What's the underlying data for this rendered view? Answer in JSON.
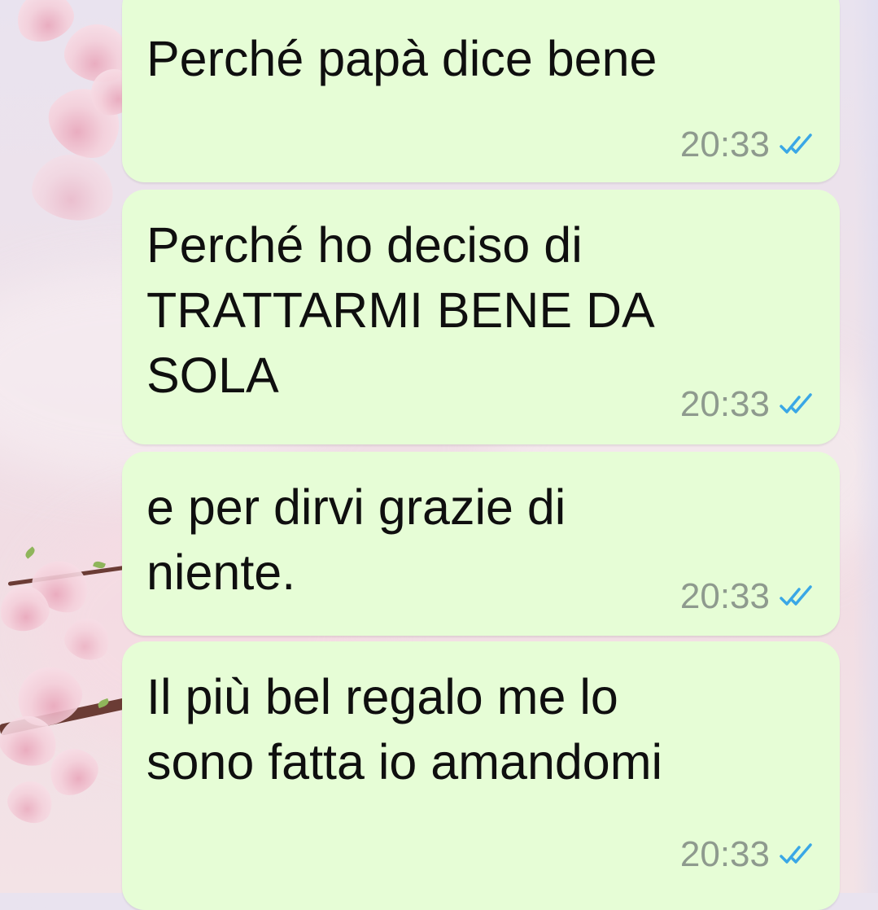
{
  "chat": {
    "messages": [
      {
        "text": "Perché papà dice bene",
        "time": "20:33",
        "status_icon": "double-check-read-icon"
      },
      {
        "text": "Perché ho deciso di\nTRATTARMI BENE DA\nSOLA",
        "time": "20:33",
        "status_icon": "double-check-read-icon"
      },
      {
        "text": "e per dirvi grazie di\nniente.",
        "time": "20:33",
        "status_icon": "double-check-read-icon"
      },
      {
        "text": "Il più bel regalo me lo\nsono fatta io amandomi",
        "time": "20:33",
        "status_icon": "double-check-read-icon"
      }
    ]
  },
  "colors": {
    "bubble": "#e6fdd6",
    "tick_read": "#3aa7e6",
    "time_text": "#8e9a8e"
  }
}
